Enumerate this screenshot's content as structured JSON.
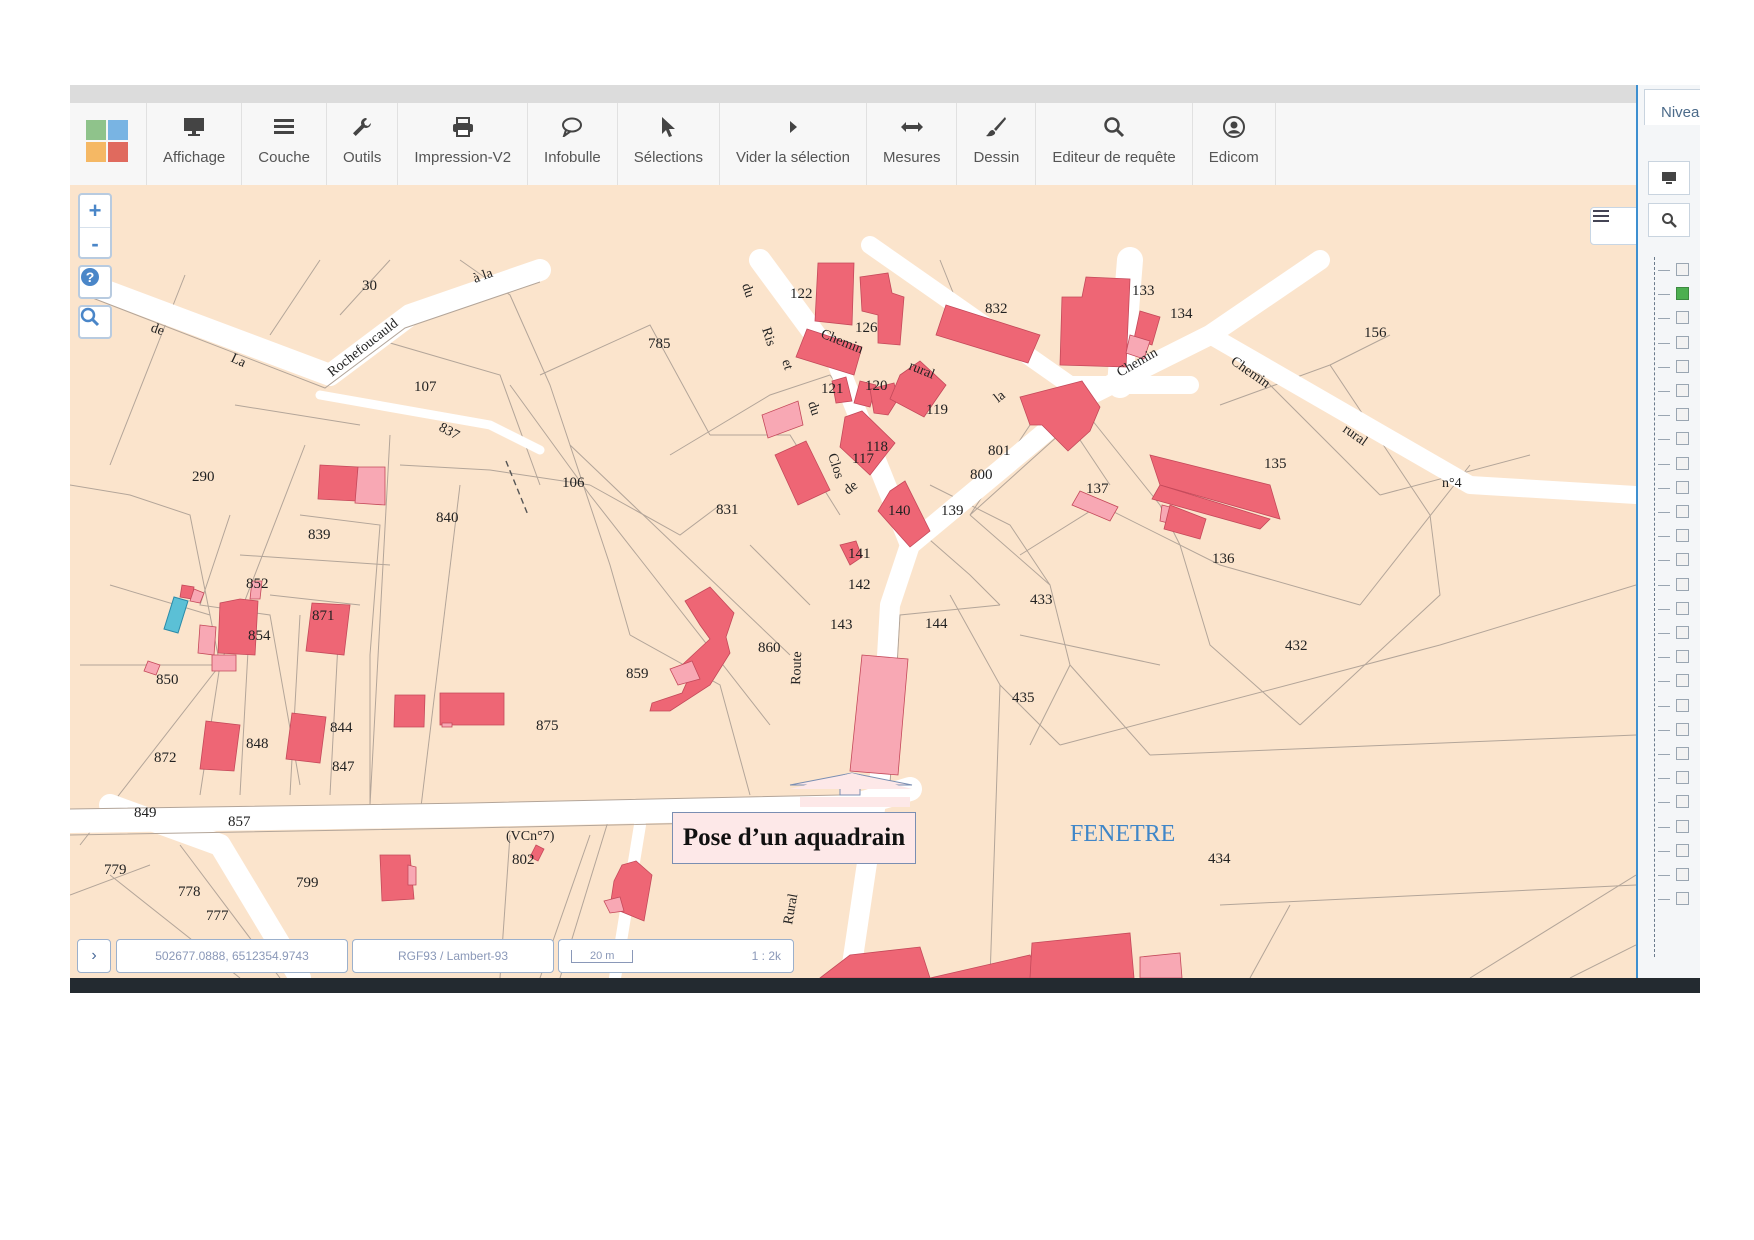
{
  "toolbar": {
    "items": [
      {
        "label": "Affichage",
        "icon": "monitor-icon"
      },
      {
        "label": "Couche",
        "icon": "layers-icon"
      },
      {
        "label": "Outils",
        "icon": "wrench-icon"
      },
      {
        "label": "Impression-V2",
        "icon": "printer-icon"
      },
      {
        "label": "Infobulle",
        "icon": "speech-bubble-icon"
      },
      {
        "label": "Sélections",
        "icon": "cursor-icon"
      },
      {
        "label": "Vider la sélection",
        "icon": "triangle-right-icon"
      },
      {
        "label": "Mesures",
        "icon": "measure-arrows-icon"
      },
      {
        "label": "Dessin",
        "icon": "brush-icon"
      },
      {
        "label": "Editeur de requête",
        "icon": "search-icon"
      },
      {
        "label": "Edicom",
        "icon": "user-circle-icon"
      }
    ]
  },
  "zoom": {
    "in": "+",
    "out": "-"
  },
  "map": {
    "parcels": [
      "30",
      "122",
      "126",
      "832",
      "133",
      "134",
      "156",
      "785",
      "107",
      "290",
      "839",
      "840",
      "106",
      "831",
      "121",
      "120",
      "119",
      "801",
      "137",
      "135",
      "118",
      "117",
      "800",
      "140",
      "139",
      "141",
      "142",
      "143",
      "144",
      "433",
      "136",
      "852",
      "871",
      "854",
      "850",
      "859",
      "860",
      "432",
      "435",
      "875",
      "844",
      "848",
      "872",
      "847",
      "849",
      "857",
      "779",
      "778",
      "777",
      "799",
      "802",
      "434"
    ],
    "street_words": [
      "de",
      "La",
      "Rochefoucauld",
      "à la",
      "du",
      "Ris",
      "et",
      "du",
      "Clos",
      "de",
      "Chemin",
      "rural",
      "la",
      "Chemin",
      "Chemin",
      "rural",
      "n°4",
      "837",
      "Route",
      "(VCn°7)",
      "Rural"
    ],
    "place_name": "FENETRE",
    "annotation": "Pose d’un aquadrain"
  },
  "statusbar": {
    "coords": "502677.0888, 6512354.9743",
    "projection": "RGF93 / Lambert-93",
    "scale_bar": "20 m",
    "scale_ratio": "1 : 2k"
  },
  "right_panel": {
    "tab": "Nivea"
  },
  "colors": {
    "parcel": "#fbe4cc",
    "building": "#ee6675",
    "building_light": "#f8a8b4",
    "road": "#ffffff",
    "place": "#3f86c8"
  }
}
